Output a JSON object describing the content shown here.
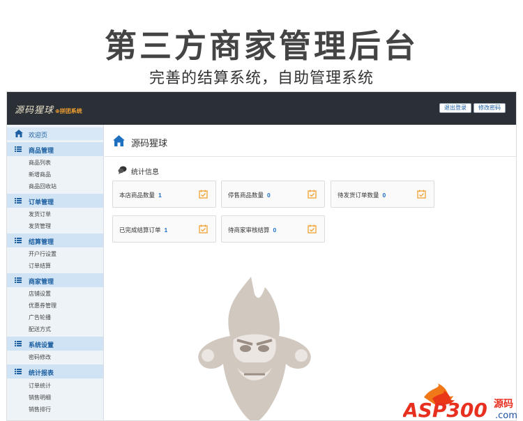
{
  "banner": {
    "title": "第三方商家管理后台",
    "subtitle": "完善的结算系统，自助管理系统"
  },
  "topbar": {
    "logo": "源码猩球",
    "logo_sub": "⊕拼团系统",
    "buttons": [
      "退出登录",
      "修改密码"
    ]
  },
  "sidebar": {
    "home": "欢迎页",
    "groups": [
      {
        "label": "商品管理",
        "items": [
          "商品列表",
          "新增商品",
          "商品回收站"
        ]
      },
      {
        "label": "订单管理",
        "items": [
          "发货订单",
          "发货管理"
        ]
      },
      {
        "label": "结算管理",
        "items": [
          "开户行设置",
          "订单结算"
        ]
      },
      {
        "label": "商家管理",
        "items": [
          "店铺设置",
          "优惠券管理",
          "广告轮播",
          "配送方式"
        ]
      },
      {
        "label": "系统设置",
        "items": [
          "密码修改"
        ]
      },
      {
        "label": "统计报表",
        "items": [
          "订单统计",
          "销售明细",
          "销售排行"
        ]
      }
    ]
  },
  "main": {
    "title": "源码猩球",
    "section": "统计信息",
    "cards": [
      {
        "label": "本店商品数量",
        "value": "1"
      },
      {
        "label": "停售商品数量",
        "value": "0"
      },
      {
        "label": "待发货订单数量",
        "value": "0"
      },
      {
        "label": "已完成结算订单",
        "value": "1"
      },
      {
        "label": "待商家审核结算",
        "value": "0"
      }
    ]
  },
  "footer_logo": {
    "brand": "ASP300",
    "suffix": "源码",
    "domain": ".com"
  },
  "colors": {
    "topbar": "#2b2f36",
    "accent": "#1a6fc9",
    "sidebar_group": "#cfe3f5",
    "card_icon": "#f0a030"
  }
}
